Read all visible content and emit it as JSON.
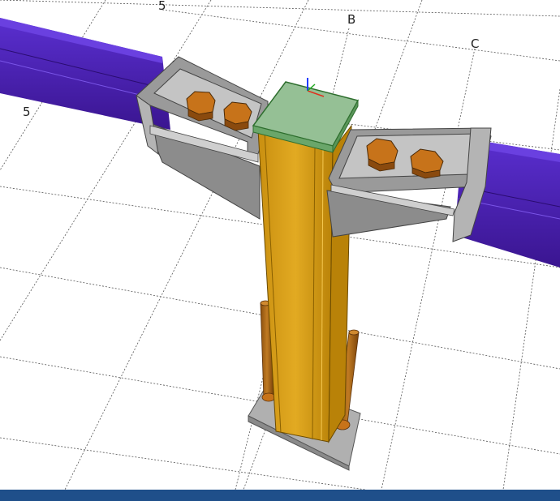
{
  "viewport": {
    "grid_labels": {
      "row_5": "5",
      "col_b": "B",
      "col_c": "C",
      "row_5_left": "5"
    }
  },
  "colors": {
    "beam": "#4b1fb0",
    "column": "#d9a11e",
    "steel_plate": "#a8a8a8",
    "cap_plate": "#8fbf8f",
    "bolt": "#c7731a",
    "anchor_rod": "#b06a1a",
    "status_bar": "#1f4f8a"
  },
  "statusbar": {
    "color": "#1f4f8a"
  }
}
